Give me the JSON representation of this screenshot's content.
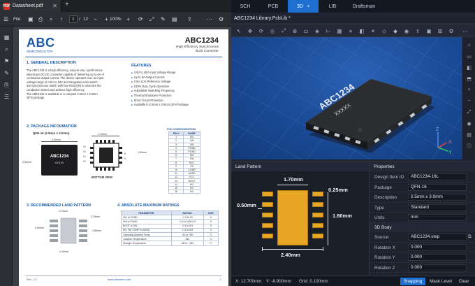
{
  "pdf": {
    "tab_title": "Datasheet.pdf",
    "file_label": "File",
    "page_current": "1",
    "page_total": "12",
    "zoom": "100%",
    "doc": {
      "logo": "ABC",
      "logo_sub": "SEMICONDUCTOR",
      "part": "ABC1234",
      "subtitle1": "High Efficiency Synchronous",
      "subtitle2": "Buck Converter",
      "sec1": "1.   GENERAL DESCRIPTION",
      "desc": [
        "The ABC1234 is a high efficiency, easy-to-use, synchronous",
        "step-down DC-DC converter capable of delivering up to 6A of",
        "continuous output current. The device operates over an input",
        "voltage range of 4.5V to 18V and integrates main switch",
        "and synchronous switch with low RDS(ON) to minimize the",
        "conduction losses and achieve high efficiency.",
        "The ABC1234 is available in a compact 2.5mm x 3.0mm",
        "QFN package."
      ],
      "features_title": "FEATURES",
      "features": [
        "4.5V to 18V Input Voltage Range",
        "Up to 6A Output Current",
        "0.6V ±1% Reference Voltage",
        "100% Duty Cycle Operation",
        "Adjustable Switching Frequency",
        "Thermal Shutdown Protection",
        "Short Circuit Protection",
        "Available in 2.5mm x 3.0mm QFN Package"
      ],
      "sec2": "2.   PACKAGE INFORMATION",
      "pkg_name": "QFN-16 (2.5mm x 3.0mm)",
      "pkg_w": "3.00mm",
      "pkg_h": "2.50mm",
      "chip_label": "ABC1234",
      "chip_sub": "XXXXX",
      "bv_top": "1.70mm",
      "bv_right": "1.80mm",
      "bottom_view": "BOTTOM VIEW",
      "pin_nums_left": [
        "16",
        "15",
        "14",
        "13"
      ],
      "pin_nums_top": [
        "1",
        "2",
        "3",
        "4"
      ],
      "pin_nums_right": [
        "8",
        "9"
      ],
      "pin_config_title": "PIN CONFIGURATION",
      "pin_headers": [
        "PIN #",
        "NAME"
      ],
      "pins": [
        [
          "1",
          "EN"
        ],
        [
          "2",
          "VIN"
        ],
        [
          "3",
          "VIN"
        ],
        [
          "4",
          "PGND"
        ],
        [
          "5",
          "PGND"
        ],
        [
          "6",
          "SW"
        ],
        [
          "7",
          "SW"
        ],
        [
          "8",
          "BST"
        ],
        [
          "9",
          "FB"
        ],
        [
          "10",
          "COMP"
        ],
        [
          "11",
          "AGND"
        ],
        [
          "12",
          "VCC"
        ],
        [
          "13",
          "BOOT"
        ],
        [
          "14",
          "NC"
        ],
        [
          "15",
          "NC"
        ],
        [
          "16",
          "NC"
        ]
      ],
      "sec3": "3.   RECOMMENDED LAND PATTERN",
      "lp_top": "1.70mm",
      "lp_tr": "0.25mm",
      "lp_left": "0.50mm",
      "lp_right": "1.80mm",
      "lp_bottom": "2.40mm",
      "sec4": "4.   ABSOLUTE MAXIMUM RATINGS",
      "amr_headers": [
        "PARAMETER",
        "RATING",
        "UNIT"
      ],
      "amr": [
        [
          "VIN to PGND",
          "-0.3 to 20",
          "V"
        ],
        [
          "SW to PGND",
          "-0.3 to VIN+0.3",
          "V"
        ],
        [
          "BOOT to SW",
          "-0.3 to 6.5",
          "V"
        ],
        [
          "EN, FB, COMP to AGND",
          "-0.3 to 6.5",
          "V"
        ],
        [
          "Operating Ambient Temp.",
          "-40 to +85",
          "°C"
        ],
        [
          "Junction Temperature",
          "150",
          "°C"
        ],
        [
          "Storage Temperature",
          "-65 to +150",
          "°C"
        ]
      ],
      "footer_rev": "Rev. 1.0",
      "footer_url": "www.abcsemi.com",
      "footer_page": "1"
    }
  },
  "cad": {
    "tabs": [
      "SCH",
      "PCB",
      "3D",
      "LIB",
      "Draftsman"
    ],
    "doc_tab": "ABC1234 Library.PcbLib *",
    "chip_marking": "ABC1234",
    "chip_sub": "XXXXX",
    "axes": {
      "z": "Z",
      "y": "Y",
      "x": "X"
    },
    "land_pattern": {
      "title": "Land Pattern",
      "dim_top": "1.70mm",
      "dim_tr": "0.25mm",
      "dim_left": "0.50mm",
      "dim_right": "1.80mm",
      "dim_bottom": "2.40mm"
    },
    "properties": {
      "title": "Properties",
      "rows": [
        {
          "k": "Design Item ID",
          "v": "ABC1234-16L"
        },
        {
          "k": "Package",
          "v": "QFN-16"
        },
        {
          "k": "Description",
          "v": "2.5mm x 3.0mm"
        },
        {
          "k": "Type",
          "v": "Standard"
        },
        {
          "k": "Units",
          "v": "mm"
        }
      ],
      "section_3d": "3D Body",
      "rows3d": [
        {
          "k": "Source",
          "v": "ABC1234.step"
        },
        {
          "k": "Rotation X",
          "v": "0.000"
        },
        {
          "k": "Rotation Y",
          "v": "0.000"
        },
        {
          "k": "Rotation Z",
          "v": "0.000"
        }
      ]
    },
    "status": {
      "x": "X: 12.700mm",
      "y": "Y: -8.900mm",
      "grid": "Grid: 0.100mm",
      "snapping": "Snapping",
      "mask_level": "Mask Level",
      "clear": "Clear"
    },
    "colors": {
      "accent": "#1f6fd1",
      "pad": "#e7a724",
      "view_bg": "#1c4d99"
    }
  }
}
